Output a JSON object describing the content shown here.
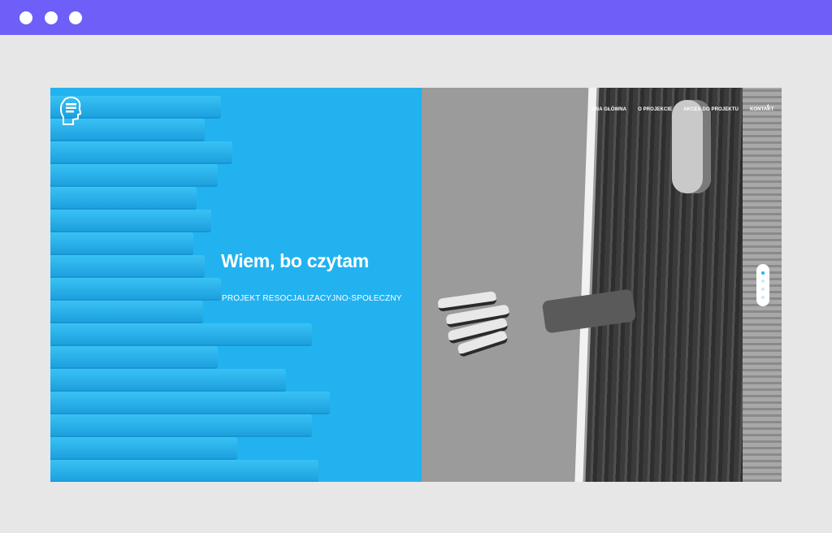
{
  "window": {
    "controls": [
      "window-dot",
      "window-dot",
      "window-dot"
    ]
  },
  "site": {
    "logo_icon": "head-book-icon",
    "nav": [
      {
        "label": "ONA GŁÓWNA"
      },
      {
        "label": "O PROJEKCIE"
      },
      {
        "label": "AKCES DO PROJEKTU"
      },
      {
        "label": "KONTAKT"
      }
    ],
    "social": {
      "facebook": "f"
    },
    "hero": {
      "title": "Wiem, bo czytam",
      "subtitle": "PROJEKT RESOCJALIZACYJNO-SPOŁECZNY"
    },
    "pager": {
      "count": 4,
      "active_index": 0
    }
  },
  "colors": {
    "titlebar": "#6d5ff8",
    "hero_blue": "#22b2f0",
    "page_bg": "#e7e7e7"
  }
}
